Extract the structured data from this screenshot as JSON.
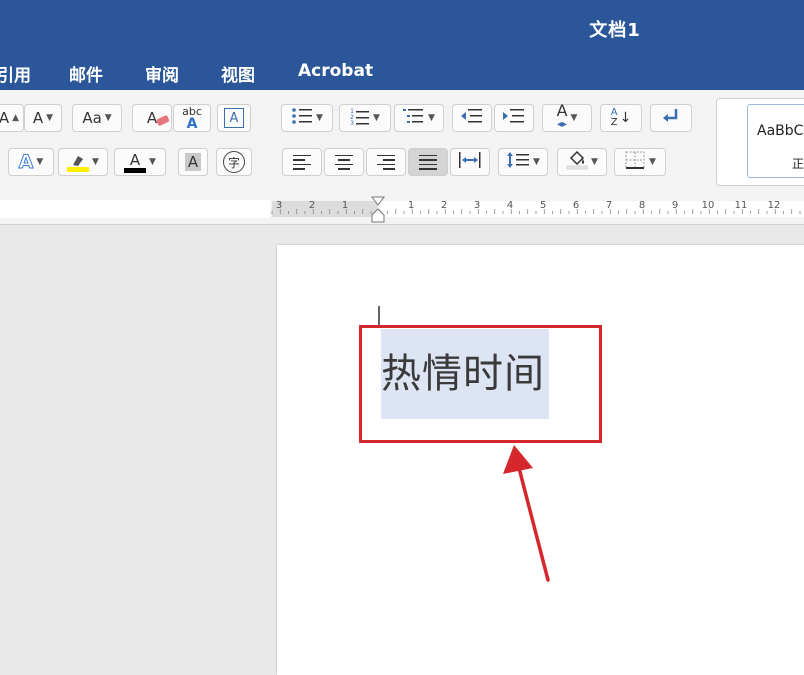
{
  "window": {
    "title": "文档1"
  },
  "tabs": [
    {
      "label": "引用"
    },
    {
      "label": "邮件"
    },
    {
      "label": "审阅"
    },
    {
      "label": "视图"
    },
    {
      "label": "Acrobat"
    }
  ],
  "ribbon": {
    "shrink_font_glyph": "A",
    "grow_font_glyph": "A",
    "change_case_glyph": "Aa",
    "clear_format_glyph": "A",
    "spell_abc": "abc",
    "spell_a": "A",
    "text_box_glyph": "A",
    "text_effects_glyph": "A",
    "font_color_glyph": "A",
    "char_shading_glyph": "A",
    "enclose_char_glyph": "字",
    "sort_a": "A",
    "sort_z": "Z",
    "line_spacing_glyph": "A",
    "list_numbers": [
      "1",
      "2",
      "3"
    ]
  },
  "styles": {
    "preview": "AaBbC",
    "current": "正"
  },
  "ruler": {
    "left_labels": [
      "3",
      "2",
      "1"
    ],
    "right_labels": [
      "1",
      "2",
      "3",
      "4",
      "5",
      "6",
      "7",
      "8",
      "9",
      "10",
      "11",
      "12"
    ]
  },
  "document": {
    "text": "热情时间"
  },
  "colors": {
    "accent": "#2b579a",
    "highlight": "#ffef00",
    "font_color": "#000000",
    "annotation": "#d6282c",
    "selection": "#dde4f4"
  }
}
